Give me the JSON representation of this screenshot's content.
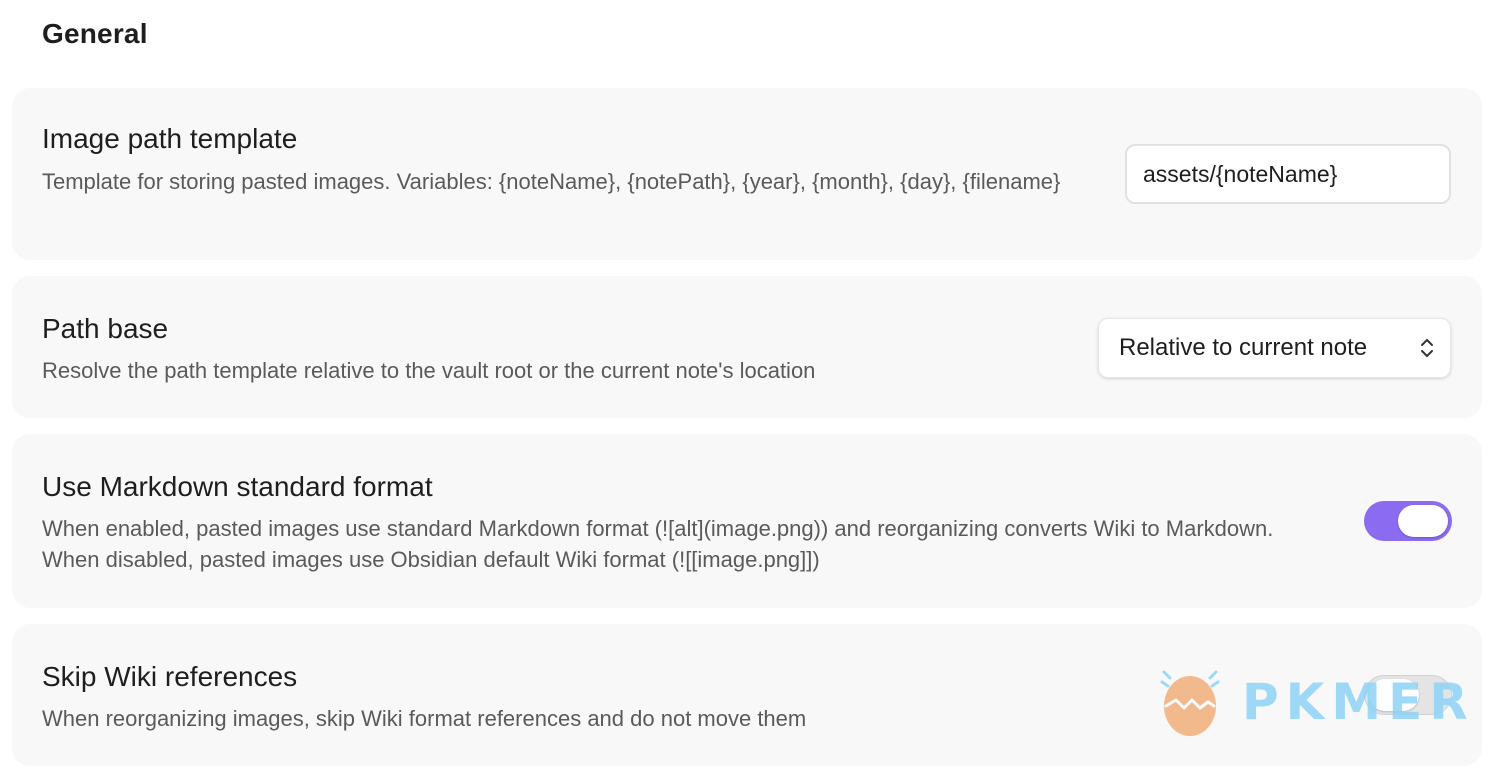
{
  "section": {
    "title": "General"
  },
  "settings": [
    {
      "title": "Image path template",
      "description": "Template for storing pasted images. Variables: {noteName}, {notePath}, {year}, {month}, {day}, {filename}",
      "control": "text",
      "value": "assets/{noteName}"
    },
    {
      "title": "Path base",
      "description": "Resolve the path template relative to the vault root or the current note's location",
      "control": "select",
      "value": "Relative to current note",
      "icon": "chevron-up-down-icon"
    },
    {
      "title": "Use Markdown standard format",
      "description": "When enabled, pasted images use standard Markdown format (![alt](image.png)) and reorganizing converts Wiki to Markdown. When disabled, pasted images use Obsidian default Wiki format (![[image.png]])",
      "control": "toggle",
      "enabled": true
    },
    {
      "title": "Skip Wiki references",
      "description": "When reorganizing images, skip Wiki format references and do not move them",
      "control": "toggle",
      "enabled": false
    }
  ],
  "watermark": {
    "text": "PKMER"
  },
  "colors": {
    "accent": "#8b6cf0",
    "card_background": "#f8f8f8",
    "toggle_off": "#e4e4e4",
    "watermark_blue": "#8fd3f7",
    "watermark_orange": "#f2b07a"
  }
}
